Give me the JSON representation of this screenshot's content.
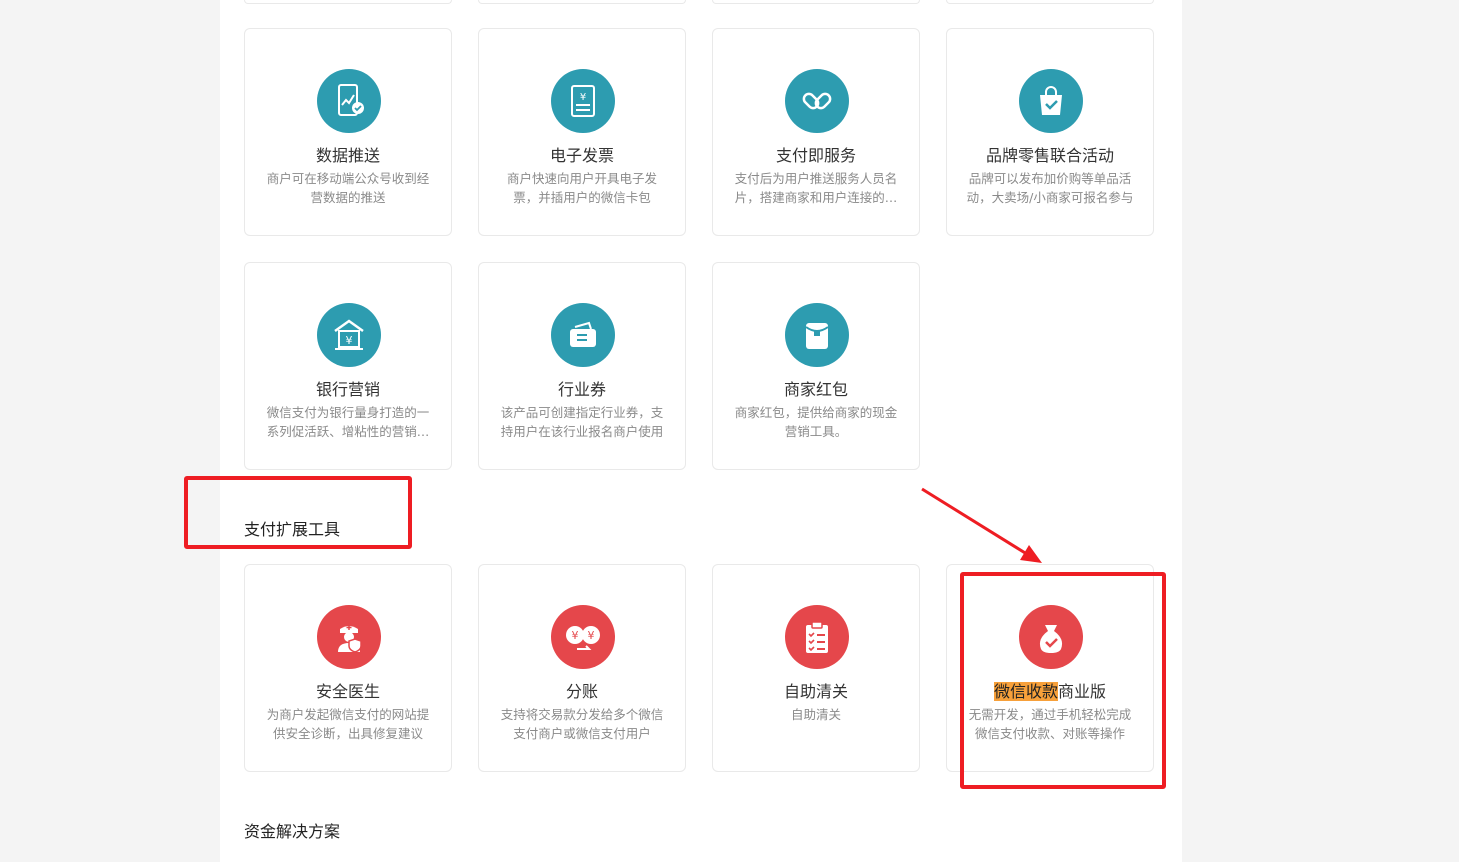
{
  "colors": {
    "teal": "#2d9cb0",
    "red": "#e5474b",
    "annotation": "#ee1d23",
    "highlight": "#f7a03a"
  },
  "row1": [
    {
      "icon": "mobile-chart-icon",
      "title": "数据推送",
      "desc": "商户可在移动端公众号收到经营数据的推送"
    },
    {
      "icon": "invoice-icon",
      "title": "电子发票",
      "desc": "商户快速向用户开具电子发票，并插用户的微信卡包"
    },
    {
      "icon": "link-icon",
      "title": "支付即服务",
      "desc": "支付后为用户推送服务人员名片，搭建商家和用户连接的桥梁"
    },
    {
      "icon": "shopping-bag-icon",
      "title": "品牌零售联合活动",
      "desc": "品牌可以发布加价购等单品活动，大卖场/小商家可报名参与"
    }
  ],
  "row2": [
    {
      "icon": "bank-icon",
      "title": "银行营销",
      "desc": "微信支付为银行量身打造的一系列促活跃、增粘性的营销工具"
    },
    {
      "icon": "wallet-icon",
      "title": "行业券",
      "desc": "该产品可创建指定行业券，支持用户在该行业报名商户使用"
    },
    {
      "icon": "red-envelope-icon",
      "title": "商家红包",
      "desc": "商家红包，提供给商家的现金营销工具。"
    }
  ],
  "section_payment_tools": "支付扩展工具",
  "row3": [
    {
      "icon": "doctor-shield-icon",
      "title": "安全医生",
      "desc": "为商户发起微信支付的网站提供安全诊断，出具修复建议"
    },
    {
      "icon": "split-money-icon",
      "title": "分账",
      "desc": "支持将交易款分发给多个微信支付商户或微信支付用户"
    },
    {
      "icon": "clipboard-check-icon",
      "title": "自助清关",
      "desc": "自助清关"
    },
    {
      "icon": "money-bag-check-icon",
      "title_highlight": "微信收款",
      "title_rest": "商业版",
      "desc": "无需开发，通过手机轻松完成微信支付收款、对账等操作"
    }
  ],
  "section_fund_solutions": "资金解决方案"
}
